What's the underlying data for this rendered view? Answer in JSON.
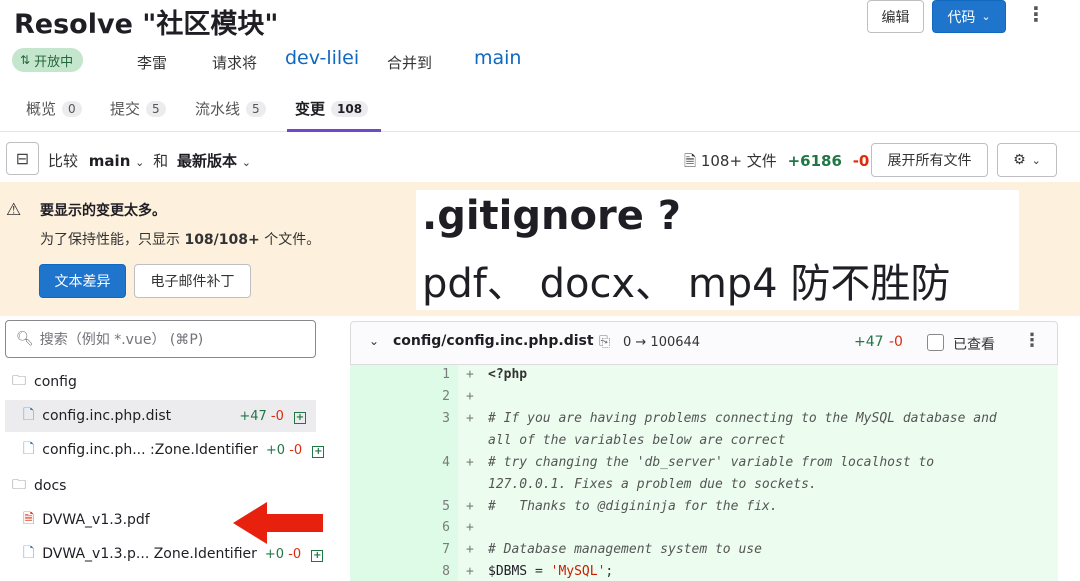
{
  "header": {
    "title": "Resolve \"社区模块\"",
    "edit_label": "编辑",
    "code_label": "代码",
    "status_badge": "开放中",
    "author": "李雷",
    "request_text": "请求将",
    "source_branch": "dev-lilei",
    "merge_text": "合并到",
    "target_branch": "main"
  },
  "tabs": [
    {
      "label": "概览",
      "count": "0"
    },
    {
      "label": "提交",
      "count": "5"
    },
    {
      "label": "流水线",
      "count": "5"
    },
    {
      "label": "变更",
      "count": "108"
    }
  ],
  "toolbar": {
    "compare_label": "比较",
    "base_branch": "main",
    "and_label": "和",
    "head_version": "最新版本",
    "files_label": "108+ 文件",
    "additions": "+6186",
    "deletions": "-0",
    "expand_all_label": "展开所有文件"
  },
  "warning": {
    "title": "要显示的变更太多。",
    "text_prefix": "为了保持性能，只显示",
    "text_count": "108/108+",
    "text_suffix": "个文件。",
    "text_diff_button": "文本差异",
    "email_patch_button": "电子邮件补丁"
  },
  "overlay": {
    "line1": ".gitignore ?",
    "line2": "pdf、 docx、 mp4 防不胜防"
  },
  "file_tree": {
    "search_placeholder": "搜索（例如 *.vue） (⌘P)",
    "items": [
      {
        "type": "folder",
        "name": "config"
      },
      {
        "type": "file",
        "name": "config.inc.php.dist",
        "add": "+47",
        "del": "-0"
      },
      {
        "type": "file",
        "name": "config.inc.ph... :Zone.Identifier",
        "add": "+0",
        "del": "-0"
      },
      {
        "type": "folder",
        "name": "docs"
      },
      {
        "type": "pdf",
        "name": "DVWA_v1.3.pdf"
      },
      {
        "type": "file",
        "name": "DVWA_v1.3.p... Zone.Identifier",
        "add": "+0",
        "del": "-0"
      }
    ]
  },
  "diff": {
    "file_path": "config/config.inc.php.dist",
    "mode_change": "0 → 100644",
    "additions": "+47",
    "deletions": "-0",
    "viewed_label": "已查看",
    "lines": [
      {
        "num": "1",
        "code": "<?php"
      },
      {
        "num": "2",
        "code": ""
      },
      {
        "num": "3",
        "code": "# If you are having problems connecting to the MySQL database and"
      },
      {
        "num": "",
        "code": "all of the variables below are correct"
      },
      {
        "num": "4",
        "code": "# try changing the 'db_server' variable from localhost to"
      },
      {
        "num": "",
        "code": "127.0.0.1. Fixes a problem due to sockets."
      },
      {
        "num": "5",
        "code": "#   Thanks to @digininja for the fix."
      },
      {
        "num": "6",
        "code": ""
      },
      {
        "num": "7",
        "code": "# Database management system to use"
      },
      {
        "num": "8",
        "code_var": "$DBMS",
        "code_eq": " = ",
        "code_str": "'MySQL'",
        "code_end": ";"
      }
    ]
  }
}
